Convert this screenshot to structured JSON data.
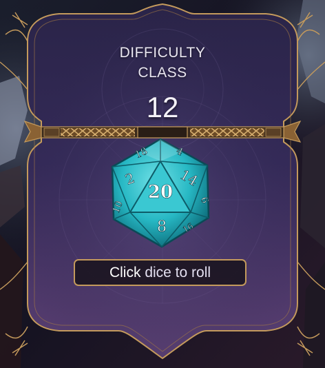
{
  "difficulty": {
    "label_line1": "DIFFICULTY",
    "label_line2": "CLASS",
    "value": "12"
  },
  "die": {
    "type": "d20",
    "top_face": "20",
    "faces": [
      "18",
      "4",
      "2",
      "14",
      "8",
      "10",
      "6",
      "16"
    ],
    "color": "#27b8c4"
  },
  "roll_button": {
    "label_click": "Click",
    "label_rest": "dice to roll"
  },
  "colors": {
    "frame_gold": "#c49a5c",
    "panel_purple": "#3b2a58",
    "panel_deep": "#1c1533"
  }
}
